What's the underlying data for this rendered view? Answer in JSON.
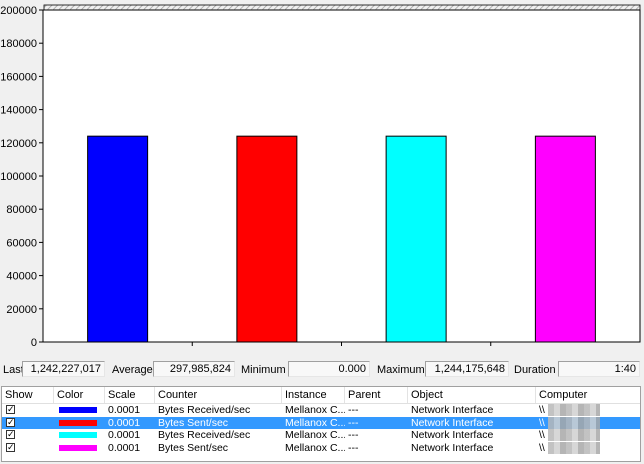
{
  "chart_data": {
    "type": "bar",
    "categories": [
      "Bytes Received/sec",
      "Bytes Sent/sec",
      "Bytes Received/sec",
      "Bytes Sent/sec"
    ],
    "values": [
      124000,
      124000,
      124000,
      124000
    ],
    "colors": [
      "#0000ff",
      "#ff0000",
      "#00ffff",
      "#ff00ff"
    ],
    "ylim": [
      0,
      200000
    ],
    "yticks": [
      "0",
      "20000",
      "40000",
      "60000",
      "80000",
      "100000",
      "120000",
      "140000",
      "160000",
      "180000",
      "200000"
    ],
    "grid": false
  },
  "stats": {
    "last_label": "Last",
    "last_value": "1,242,227,017",
    "average_label": "Average",
    "average_value": "297,985,824",
    "minimum_label": "Minimum",
    "minimum_value": "0.000",
    "maximum_label": "Maximum",
    "maximum_value": "1,244,175,648",
    "duration_label": "Duration",
    "duration_value": "1:40"
  },
  "legend": {
    "headers": {
      "show": "Show",
      "color": "Color",
      "scale": "Scale",
      "counter": "Counter",
      "instance": "Instance",
      "parent": "Parent",
      "object": "Object",
      "computer": "Computer"
    },
    "rows": [
      {
        "color": "#0000ff",
        "scale": "0.0001",
        "counter": "Bytes Received/sec",
        "instance": "Mellanox C...",
        "parent": "---",
        "object": "Network Interface",
        "computer": "\\\\",
        "selected": false
      },
      {
        "color": "#ff0000",
        "scale": "0.0001",
        "counter": "Bytes Sent/sec",
        "instance": "Mellanox C...",
        "parent": "---",
        "object": "Network Interface",
        "computer": "\\\\",
        "selected": true
      },
      {
        "color": "#00ffff",
        "scale": "0.0001",
        "counter": "Bytes Received/sec",
        "instance": "Mellanox C...",
        "parent": "---",
        "object": "Network Interface",
        "computer": "\\\\",
        "selected": false
      },
      {
        "color": "#ff00ff",
        "scale": "0.0001",
        "counter": "Bytes Sent/sec",
        "instance": "Mellanox C...",
        "parent": "---",
        "object": "Network Interface",
        "computer": "\\\\",
        "selected": false
      }
    ]
  },
  "icons": {
    "checkbox_checked": "checkbox-checked-icon"
  }
}
